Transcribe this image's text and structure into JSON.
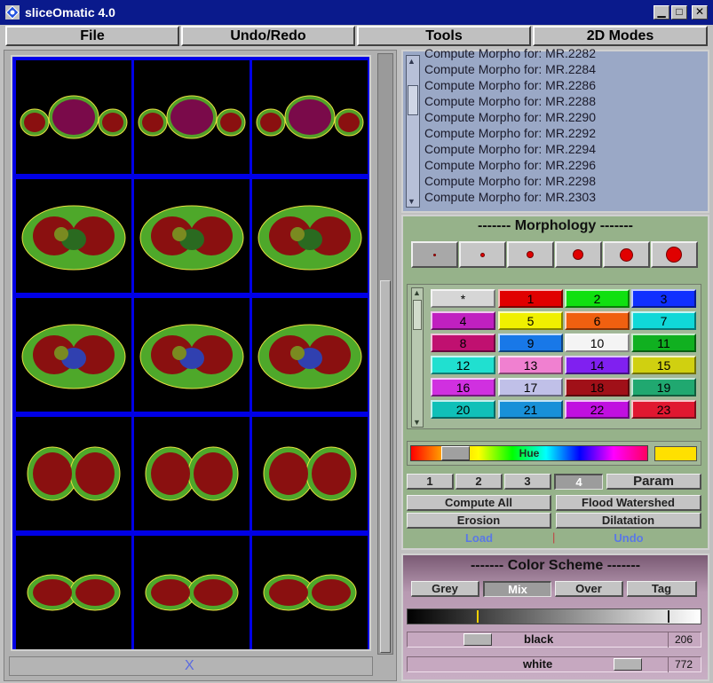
{
  "window": {
    "title": "sliceOmatic 4.0"
  },
  "menu": [
    "File",
    "Undo/Redo",
    "Tools",
    "2D Modes"
  ],
  "log": {
    "lines": [
      "Compute Morpho for: MR.2282",
      "Compute Morpho for: MR.2284",
      "Compute Morpho for: MR.2286",
      "Compute Morpho for: MR.2288",
      "Compute Morpho for: MR.2290",
      "Compute Morpho for: MR.2292",
      "Compute Morpho for: MR.2294",
      "Compute Morpho for: MR.2296",
      "Compute Morpho for: MR.2298",
      "Compute Morpho for: MR.2303"
    ]
  },
  "morphology": {
    "title": "------- Morphology -------",
    "brushes": 6,
    "tags": [
      {
        "label": "*",
        "color": "#d6d6d6"
      },
      {
        "label": "1",
        "color": "#e00000"
      },
      {
        "label": "2",
        "color": "#10e010"
      },
      {
        "label": "3",
        "color": "#1030ff"
      },
      {
        "label": "4",
        "color": "#c020c0"
      },
      {
        "label": "5",
        "color": "#f0f000"
      },
      {
        "label": "6",
        "color": "#f06010"
      },
      {
        "label": "7",
        "color": "#10d8d8"
      },
      {
        "label": "8",
        "color": "#c01070"
      },
      {
        "label": "9",
        "color": "#1878e8"
      },
      {
        "label": "10",
        "color": "#f4f4f4"
      },
      {
        "label": "11",
        "color": "#10b020"
      },
      {
        "label": "12",
        "color": "#20e0d0"
      },
      {
        "label": "13",
        "color": "#f080d0"
      },
      {
        "label": "14",
        "color": "#8020f0"
      },
      {
        "label": "15",
        "color": "#d0d010"
      },
      {
        "label": "16",
        "color": "#d030e0"
      },
      {
        "label": "17",
        "color": "#c0c0e8"
      },
      {
        "label": "18",
        "color": "#a01018"
      },
      {
        "label": "19",
        "color": "#20a870"
      },
      {
        "label": "20",
        "color": "#10c0b8"
      },
      {
        "label": "21",
        "color": "#1890d8"
      },
      {
        "label": "22",
        "color": "#c010e0"
      },
      {
        "label": "23",
        "color": "#e01830"
      }
    ],
    "hue_label": "Hue",
    "hue_swatch_color": "#ffe000",
    "mode_buttons": [
      "1",
      "2",
      "3",
      "4"
    ],
    "active_mode": "4",
    "param_label": "Param",
    "compute_all": "Compute All",
    "flood_watershed": "Flood Watershed",
    "erosion": "Erosion",
    "dilatation": "Dilatation",
    "load": "Load",
    "undo": "Undo"
  },
  "color_scheme": {
    "title": "------- Color Scheme -------",
    "modes": [
      "Grey",
      "Mix",
      "Over",
      "Tag"
    ],
    "active_mode": "Mix",
    "black_label": "black",
    "black_value": "206",
    "white_label": "white",
    "white_value": "772"
  },
  "image_area": {
    "bottom_icon": "X"
  }
}
